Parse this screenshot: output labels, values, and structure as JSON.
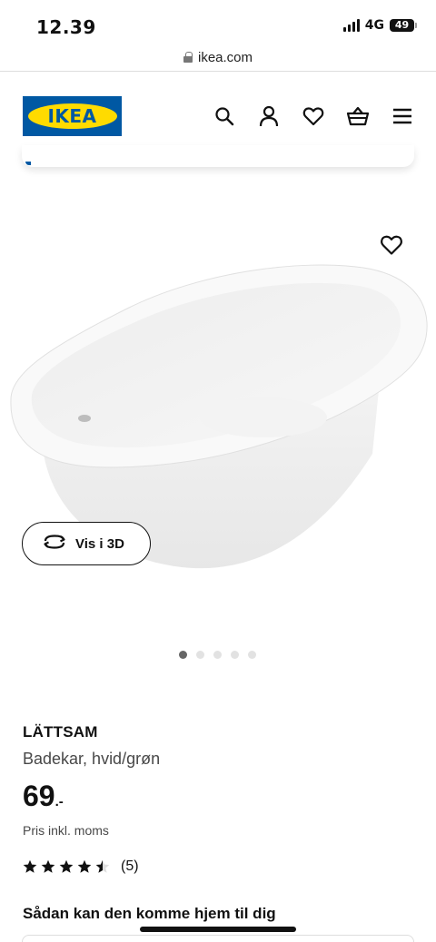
{
  "status_bar": {
    "time": "12.39",
    "network": "4G",
    "battery": "49"
  },
  "browser": {
    "url": "ikea.com"
  },
  "header": {
    "logo_text": "IKEA",
    "colors": {
      "blue": "#0058a3",
      "yellow": "#ffdb00"
    },
    "icons": [
      "search-icon",
      "account-icon",
      "wishlist-icon",
      "basket-icon",
      "menu-icon"
    ]
  },
  "gallery": {
    "view_3d_label": "Vis i 3D",
    "image_count": 5,
    "active_index": 0
  },
  "product": {
    "name": "LÄTTSAM",
    "description": "Badekar, hvid/grøn",
    "price_integer": "69",
    "price_suffix": ".-",
    "price_note": "Pris inkl. moms",
    "rating_value": 4.5,
    "rating_max": 5,
    "rating_count": "(5)"
  },
  "delivery": {
    "title": "Sådan kan den komme hjem til dig"
  }
}
